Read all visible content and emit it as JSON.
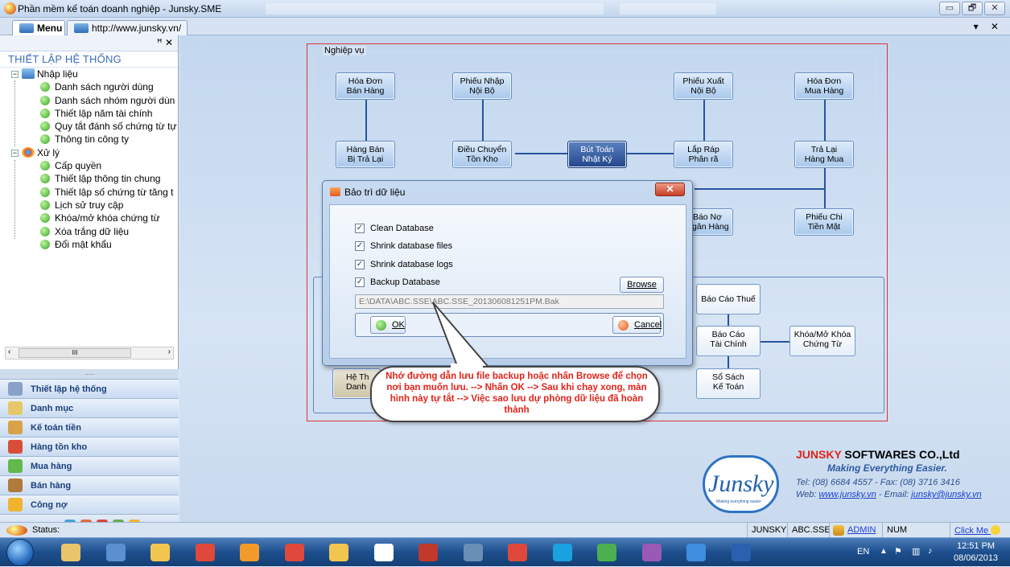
{
  "window": {
    "title": "Phần mềm kế toán doanh nghiệp - Junsky.SME",
    "controls": [
      "▭",
      "🗗",
      "✕"
    ]
  },
  "tabs": [
    {
      "label": "Menu"
    },
    {
      "label": "http://www.junsky.vn/"
    }
  ],
  "tab_controls": "▾ ✕",
  "left_panel": {
    "pin": "ꟸ ✕",
    "title": "THIẾT LẬP HỆ THỐNG",
    "groups": [
      {
        "label": "Nhập liệu",
        "items": [
          "Danh sách người dùng",
          "Danh sách nhóm người dùn",
          "Thiết lập năm tài chính",
          "Quy tắt đánh số chứng từ tự",
          "Thông tin công ty"
        ]
      },
      {
        "label": "Xử lý",
        "items": [
          "Cấp quyền",
          "Thiết lập thông tin chung",
          "Thiết lập số chứng từ tăng t",
          "Lịch sử truy cập",
          "Khóa/mở khóa chứng từ",
          "Xóa trắng dữ liệu",
          "Đổi mật khẩu"
        ]
      }
    ],
    "scroll_grip": "III",
    "nav_grip": ".....",
    "nav": [
      {
        "label": "Thiết lập hệ thống",
        "color": "#8aa0c8"
      },
      {
        "label": "Danh mục",
        "color": "#e6c86a"
      },
      {
        "label": "Kế toán tiền",
        "color": "#d7a248"
      },
      {
        "label": "Hàng tồn kho",
        "color": "#d84d3a"
      },
      {
        "label": "Mua hàng",
        "color": "#62b84a"
      },
      {
        "label": "Bán hàng",
        "color": "#b07a3c"
      },
      {
        "label": "Công nợ",
        "color": "#f0b32e"
      }
    ]
  },
  "workflow": {
    "section_label": "Nghiệp vụ",
    "boxes": {
      "hoa_don_ban_hang": "Hóa Đơn\nBán Hàng",
      "phieu_nhap_noi_bo": "Phiếu Nhập\nNội Bộ",
      "phieu_xuat_noi_bo": "Phiếu Xuất\nNội Bộ",
      "hoa_don_mua_hang": "Hóa Đơn\nMua Hàng",
      "hang_ban_bi_tra_lai": "Hàng Bán\nBị Trả Lại",
      "dieu_chuyen_ton_kho": "Điều Chuyển\nTồn Kho",
      "but_toan_nhat_ky": "Bút Toán\nNhật Ký",
      "lap_rap_phan_ra": "Lắp Ráp\nPhân rã",
      "tra_lai_hang_mua": "Trả Lại\nHàng Mua",
      "bao_no_ngan_hang": "Báo Nợ\nNgân Hàng",
      "phieu_chi_tien_mat": "Phiếu Chi\nTiền Mặt",
      "bao_cao_thue": "Báo Cáo Thuế",
      "bao_cao_tai_chinh": "Báo Cáo\nTài Chính",
      "khoa_mo_khoa": "Khóa/Mở Khóa\nChứng Từ",
      "so_sach_ke_toan": "Sổ Sách\nKế Toán",
      "he_thong_partial": "Hệ Th\nDanh"
    }
  },
  "dialog": {
    "title": "Bảo trì dữ liệu",
    "close": "✕",
    "options": [
      {
        "label": "Clean Database",
        "checked": true
      },
      {
        "label": "Shrink database files",
        "checked": true
      },
      {
        "label": "Shrink database logs",
        "checked": true
      },
      {
        "label": "Backup Database",
        "checked": true
      }
    ],
    "browse_label": "Browse",
    "path_value": "E:\\DATA\\ABC.SSE\\ABC.SSE_201306081251PM.Bak",
    "ok_label": "OK",
    "cancel_label": "Cancel"
  },
  "callout": "Nhớ đường dẫn lưu file backup hoặc nhấn Browse để chọn nơi bạn muốn lưu. --> Nhấn OK --> Sau khi chạy xong, màn hình này tự tắt --> Việc sao lưu dự phòng dữ liệu đã hoàn thành",
  "brand": {
    "logo_text": "Junsky",
    "logo_small": "Making everything easier",
    "company_red": "JUNSKY",
    "company_rest": " SOFTWARES CO.,Ltd",
    "slogan": "Making Everything Easier.",
    "tel": "Tel: (08) 6684 4557 - Fax: (08) 3716 3416",
    "web_prefix": "Web: ",
    "web": "www.junsky.vn",
    "email_prefix": " - Email: ",
    "email": "junsky@junsky.vn"
  },
  "status_bar": {
    "status_label": "Status:",
    "user_org": "JUNSKY",
    "db": "ABC.SSE",
    "user": "ADMIN",
    "mode": "NUM",
    "click_me": "Click Me"
  },
  "taskbar": {
    "lang": "EN",
    "time": "12:51 PM",
    "date": "08/06/2013",
    "apps": [
      "explorer",
      "paint",
      "keys",
      "chrome-c",
      "matlab",
      "chrome-c2",
      "keys2",
      "junsky",
      "handshake",
      "tool",
      "chrome",
      "skype",
      "camtasia",
      "games",
      "teamviewer",
      "word"
    ]
  }
}
